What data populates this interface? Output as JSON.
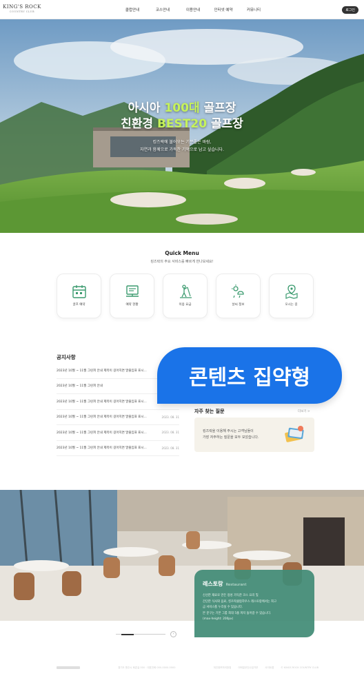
{
  "header": {
    "logo_main": "KING'S ROCK",
    "logo_sub": "COUNTRY CLUB",
    "nav": [
      "클럽안내",
      "코스안내",
      "이용안내",
      "인터넷 예약",
      "커뮤니티"
    ],
    "login": "로그인"
  },
  "hero": {
    "line1_pre": "아시아 ",
    "line1_hl": "100대",
    "line1_post": " 골프장",
    "line2_pre": "친환경 ",
    "line2_hl": "BEST20",
    "line2_post": " 골프장",
    "desc1": "킹즈락에 불어오는 기분좋은 바람,",
    "desc2": "자연과 함께으로 가득찬 기억으로 남고 싶습니다."
  },
  "quick_menu": {
    "title": "Quick Menu",
    "subtitle": "킹즈락의 주요 서비스를 빠르게 만나보세요!",
    "items": [
      {
        "label": "골프 예약",
        "icon": "calendar-icon"
      },
      {
        "label": "예약 현황",
        "icon": "monitor-icon"
      },
      {
        "label": "이용 요금",
        "icon": "golfer-icon"
      },
      {
        "label": "날씨 정보",
        "icon": "weather-icon"
      },
      {
        "label": "오시는 길",
        "icon": "map-icon"
      }
    ]
  },
  "notice": {
    "title": "공지사항",
    "items": [
      {
        "text": "2023년 10월 ~ 11월 그린피 안내 제목이 길어지면 말줄임표 표시...",
        "date": ""
      },
      {
        "text": "2023년 10월 ~ 11월 그린피 안내",
        "date": ""
      },
      {
        "text": "2023년 10월 ~ 11월 그린피 안내 제목이 길어지면 말줄임표 표시...",
        "date": ""
      },
      {
        "text": "2023년 10월 ~ 11월 그린피 안내 제목이 길어지면 말줄임표 표시...",
        "date": "2023. 08. 31"
      },
      {
        "text": "2023년 10월 ~ 11월 그린피 안내 제목이 길어지면 말줄임표 표시...",
        "date": "2023. 08. 31"
      },
      {
        "text": "2023년 10월 ~ 11월 그린피 안내 제목이 길어지면 말줄임표 표시...",
        "date": "2023. 08. 31"
      }
    ]
  },
  "banner": {
    "text": "콘텐츠 집약형",
    "color": "#1a73e8"
  },
  "faq": {
    "title": "자주 찾는 질문",
    "more": "더보기 >",
    "line1": "킹즈락을 이용해 주시는 고객님들이",
    "line2": "가장 자주하는 질문을 모두 모았습니다."
  },
  "restaurant": {
    "title": "레스토랑",
    "subtitle": "Restaurant",
    "desc": [
      "신선한 재료로 만든 정성 가득한 코스 요리 및",
      "간단한 식사와 음료, 킹즈락클럽하우스 레스토랑에서는 최고",
      "급 서비스를 누리실 수 있습니다.",
      "본 문구는 기본 그룹 최대 5줄 까지 들어갈 수 있습니다.",
      "(max-height: 200px)"
    ]
  },
  "slider": {
    "next": "›"
  },
  "footer": {
    "info": "경기도 원주시 회촌길 000 · 대표전화 000-0000-0000",
    "links": [
      "개인정보처리방침",
      "이메일무단수집거부",
      "사이트맵",
      "© KINGS ROCK COUNTRY CLUB"
    ]
  },
  "colors": {
    "accent": "#1a73e8",
    "highlight": "#c6f25a",
    "icon_green": "#3a9a6e",
    "restaurant_card": "#428c76"
  }
}
